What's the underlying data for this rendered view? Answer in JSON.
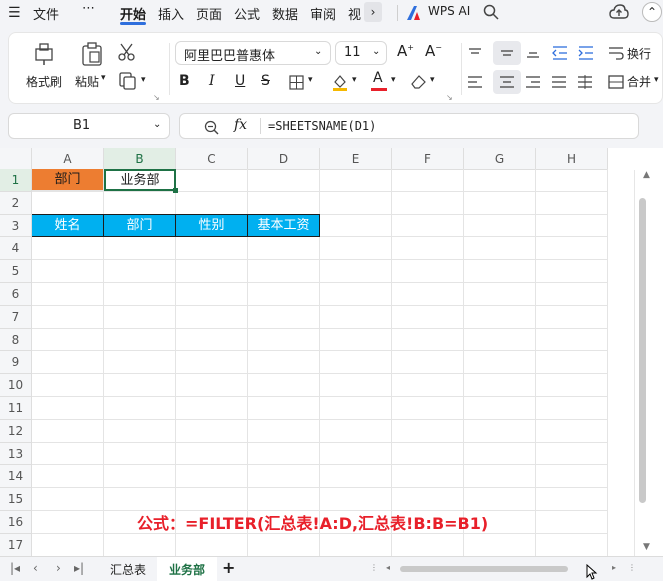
{
  "menu": {
    "file": "文件",
    "more": "⋯",
    "tabs": [
      "开始",
      "插入",
      "页面",
      "公式",
      "数据",
      "审阅",
      "视"
    ],
    "active_tab": "开始",
    "wps_ai": "WPS AI"
  },
  "ribbon": {
    "format_painter": "格式刷",
    "paste": "粘贴",
    "font_name": "阿里巴巴普惠体",
    "font_size": "11",
    "bold": "B",
    "italic": "I",
    "underline": "U",
    "wrap": "换行",
    "merge": "合并"
  },
  "formula_bar": {
    "name_box": "B1",
    "fx": "fx",
    "formula": "=SHEETSNAME(D1)"
  },
  "grid": {
    "columns": [
      "A",
      "B",
      "C",
      "D",
      "E",
      "F",
      "G",
      "H"
    ],
    "rows": [
      "1",
      "2",
      "3",
      "4",
      "5",
      "6",
      "7",
      "8",
      "9",
      "10",
      "11",
      "12",
      "13",
      "14",
      "15",
      "16",
      "17"
    ],
    "row1": {
      "a": "部门",
      "b": "业务部"
    },
    "row3": {
      "a": "姓名",
      "b": "部门",
      "c": "性别",
      "d": "基本工资"
    }
  },
  "annotation": "公式：=FILTER(汇总表!A:D,汇总表!B:B=B1)",
  "sheet_tabs": {
    "tabs": [
      "汇总表",
      "业务部"
    ],
    "active": "业务部",
    "add": "+"
  },
  "colors": {
    "orange_fill": "#ED7D31",
    "blue_fill": "#00B0F0",
    "active_green": "#1e7145",
    "annotation_red": "#e8202a"
  }
}
